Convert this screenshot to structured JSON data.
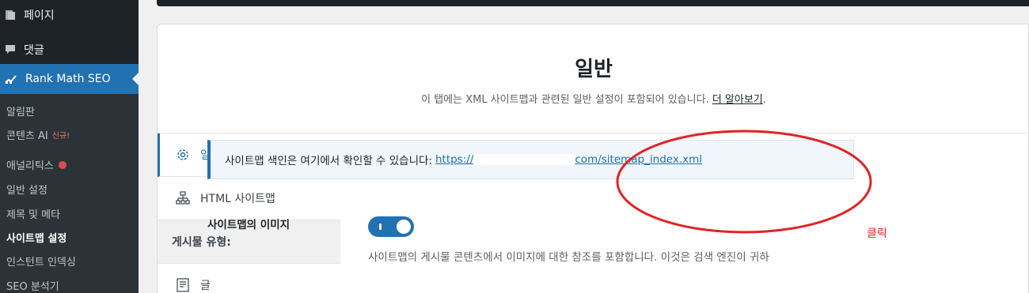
{
  "sidebar": {
    "menu": {
      "pages": "페이지",
      "comments": "댓글",
      "rankmath": "Rank Math SEO"
    },
    "submenu": [
      {
        "label": "알림판"
      },
      {
        "label": "콘텐츠 AI",
        "badge": "신규!"
      },
      {
        "label": "애널리틱스"
      },
      {
        "label": "일반 설정"
      },
      {
        "label": "제목 및 메타"
      },
      {
        "label": "사이트맵 설정"
      },
      {
        "label": "인스턴트 인덱싱"
      },
      {
        "label": "SEO 분석기"
      }
    ]
  },
  "header": {
    "title": "일반",
    "desc": "이 탭에는 XML 사이트맵과 관련된 일반 설정이 포함되어 있습니다.",
    "learn_more": "더 알아보기",
    "period": "."
  },
  "tabs": {
    "general": "일반",
    "html_sitemap": "HTML 사이트맵",
    "post_types_heading": "게시물 유형:",
    "posts": "글"
  },
  "notice": {
    "text": "사이트맵 색인은 여기에서 확인할 수 있습니다:",
    "link_prefix": "https://",
    "link_suffix": "com/sitemap_index.xml"
  },
  "images_field": {
    "label": "사이트맵의 이미지",
    "enabled": true,
    "description": "사이트맵의 게시물 콘텐츠에서 이미지에 대한 참조를 포함합니다. 이것은 검색 엔진이 귀하"
  },
  "annotation": {
    "text": "클릭",
    "color": "#e02424"
  },
  "colors": {
    "accent": "#2271b1",
    "sidebar_bg": "#1d2327"
  }
}
